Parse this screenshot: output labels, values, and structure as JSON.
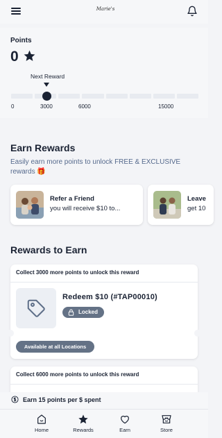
{
  "header": {
    "logo_text": "Marie's",
    "logo_tagline": ""
  },
  "points": {
    "label": "Points",
    "value": "0",
    "next_reward_label": "Next Reward",
    "ticks": [
      "0",
      "3000",
      "6000",
      "15000"
    ]
  },
  "earn": {
    "title": "Earn Rewards",
    "subtitle": "Easily earn more points to unlock FREE & EXCLUSIVE rewards 🎁",
    "cards": [
      {
        "title": "Refer a Friend",
        "subtitle": "you will receive $10 to..."
      },
      {
        "title": "Leave",
        "subtitle": "get 10"
      }
    ]
  },
  "rewards": {
    "title": "Rewards to Earn",
    "cards": [
      {
        "header": "Collect 3000 more points to unlock this reward",
        "name": "Redeem $10 (#TAP00010)",
        "status": "Locked",
        "availability": "Available at all Locations"
      },
      {
        "header": "Collect 6000 more points to unlock this reward"
      }
    ]
  },
  "earn_rate": "Earn 15 points per $ spent",
  "tabs": [
    {
      "label": "Home",
      "icon": "home-smile-icon"
    },
    {
      "label": "Rewards",
      "icon": "star-icon"
    },
    {
      "label": "Earn",
      "icon": "heart-icon"
    },
    {
      "label": "Store",
      "icon": "store-icon"
    }
  ],
  "colors": {
    "primary": "#1a2233",
    "badge": "#647286",
    "subtitle": "#55698c"
  }
}
